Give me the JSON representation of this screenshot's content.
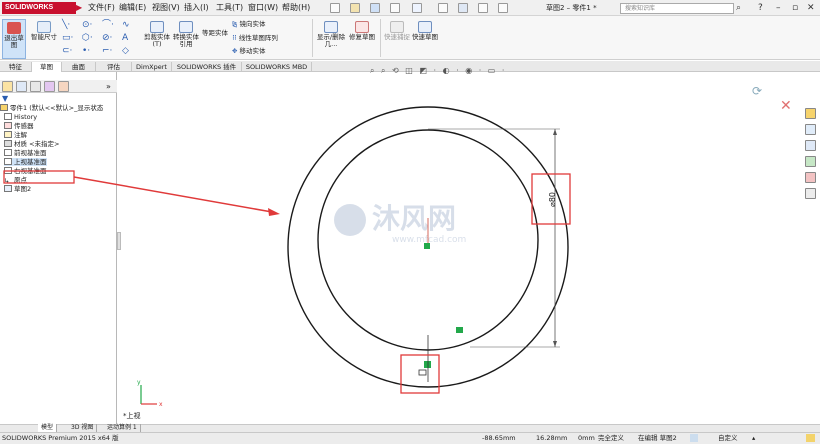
{
  "app": {
    "brand": "SOLIDWORKS",
    "doc_title": "草图2 – 零件1 *",
    "search_placeholder": "搜索知识库"
  },
  "menu": [
    "文件(F)",
    "编辑(E)",
    "视图(V)",
    "插入(I)",
    "工具(T)",
    "窗口(W)",
    "帮助(H)"
  ],
  "ribbon": {
    "exit_sketch": "退出草图",
    "smart_dim": "智能尺寸",
    "trim": "剪裁实体(T)",
    "convert": "转换实体引用",
    "offset": "等距实体",
    "mirror": "镜向实体",
    "linear_pattern": "线性草图阵列",
    "move": "移动实体",
    "show_hide": "显示/删除几...",
    "repair": "修复草图",
    "quick_snap": "快速捕捉",
    "rapid_sketch": "快速草图"
  },
  "tabs": [
    "特征",
    "草图",
    "曲面",
    "评估",
    "DimXpert",
    "SOLIDWORKS 插件",
    "SOLIDWORKS MBD"
  ],
  "tree": {
    "root": "零件1 (默认<<默认>_显示状态",
    "items": [
      "History",
      "传感器",
      "注解",
      "材质 <未指定>",
      "前视基准面",
      "上视基准面",
      "右视基准面",
      "原点",
      "草图2"
    ]
  },
  "canvas": {
    "dim_label": "⌀80",
    "view_label": "*上视",
    "axis_x": "x",
    "axis_y": "y",
    "watermark_brand": "沐风网",
    "watermark_url": "www.mfcad.com"
  },
  "bottom_tabs": [
    "模型",
    "3D 视图",
    "运动算例 1"
  ],
  "status": {
    "product": "SOLIDWORKS Premium 2015 x64 版",
    "x": "-88.65mm",
    "y": "16.28mm",
    "z": "0mm",
    "defined": "完全定义",
    "editing": "在编辑 草图2",
    "custom": "自定义"
  },
  "colors": {
    "annotation_red": "#e03a3a",
    "sketch_line": "#1a1a1a",
    "relation_green": "#22a84a",
    "brand_red": "#c8102e"
  }
}
